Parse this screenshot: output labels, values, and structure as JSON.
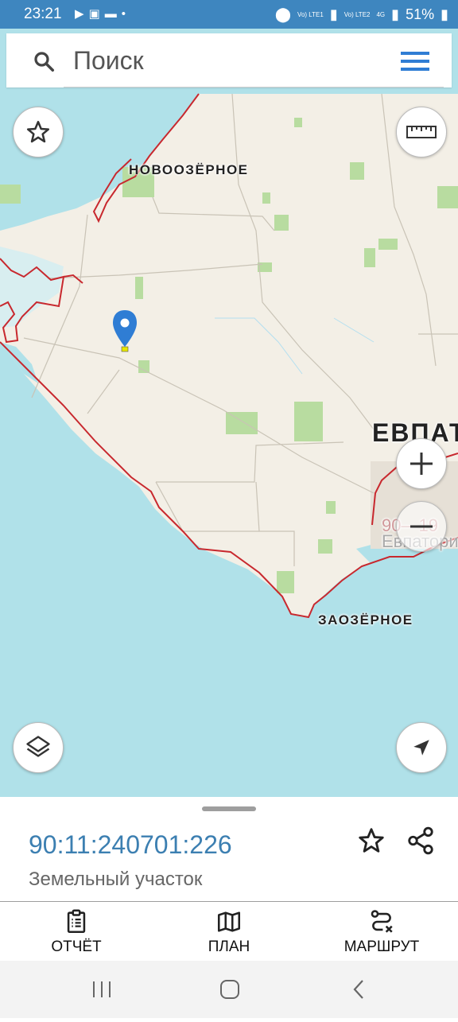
{
  "status_bar": {
    "time": "23:21",
    "left_icons": [
      "play-icon",
      "screenshot-icon",
      "folder-icon",
      "dot-icon"
    ],
    "net1": "Vo) LTE1",
    "net2": "Vo) LTE2",
    "net_type": "4G",
    "battery": "51%"
  },
  "search": {
    "placeholder": "Поиск"
  },
  "map": {
    "labels": {
      "novoozernoe": "НОВООЗЁРНОЕ",
      "evpatoria": "ЕВПАТ",
      "zaozernoe": "ЗАОЗЁРНОЕ",
      "faded_number": "90—19",
      "faded_city": "Евпатори"
    },
    "colors": {
      "land": "#f3efe6",
      "sea": "#b0e1e9",
      "boundary": "#c8282e",
      "field": "#b8dca0",
      "pin": "#2f7dd4"
    }
  },
  "sheet": {
    "cadastral_number": "90:11:240701:226",
    "object_type": "Земельный участок"
  },
  "actions": [
    {
      "label": "ОТЧЁТ",
      "icon": "clipboard-icon"
    },
    {
      "label": "ПЛАН",
      "icon": "map-icon"
    },
    {
      "label": "МАРШРУТ",
      "icon": "route-icon"
    }
  ]
}
